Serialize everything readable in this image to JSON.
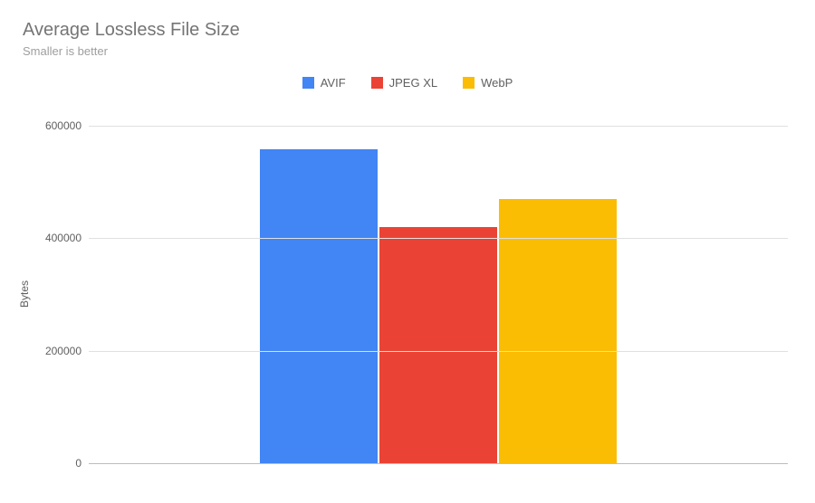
{
  "title": "Average Lossless File Size",
  "subtitle": "Smaller is better",
  "ylabel": "Bytes",
  "legend": [
    {
      "label": "AVIF",
      "color": "#4285f4"
    },
    {
      "label": "JPEG XL",
      "color": "#ea4335"
    },
    {
      "label": "WebP",
      "color": "#fbbc04"
    }
  ],
  "ticks": [
    0,
    200000,
    400000,
    600000
  ],
  "chart_data": {
    "type": "bar",
    "categories": [
      "AVIF",
      "JPEG XL",
      "WebP"
    ],
    "values": [
      558000,
      420000,
      470000
    ],
    "title": "Average Lossless File Size",
    "xlabel": "",
    "ylabel": "Bytes",
    "ylim": [
      0,
      630000
    ],
    "colors": [
      "#4285f4",
      "#ea4335",
      "#fbbc04"
    ]
  }
}
